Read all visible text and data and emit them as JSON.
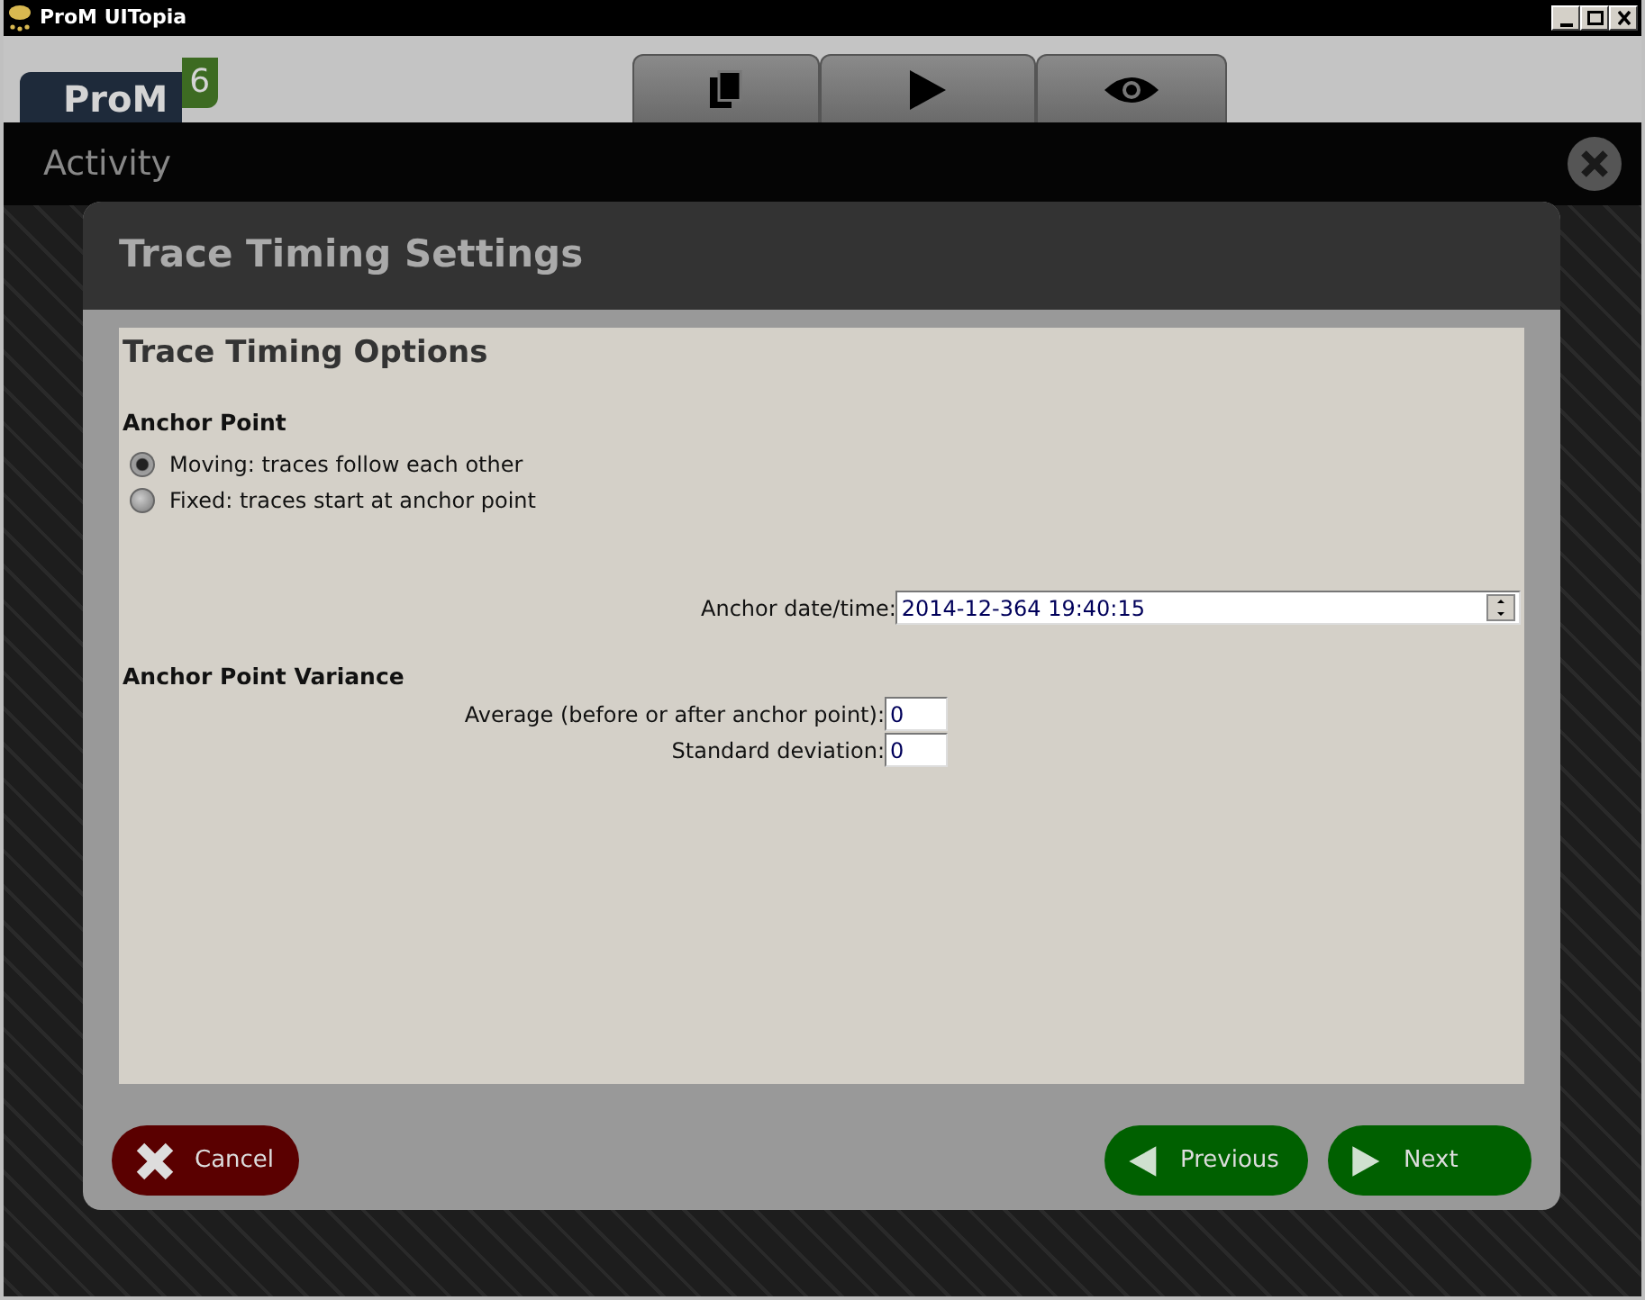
{
  "window": {
    "title": "ProM UITopia"
  },
  "logo": {
    "name": "ProM",
    "version": "6"
  },
  "tabs": [
    {
      "kind": "workspace"
    },
    {
      "kind": "actions"
    },
    {
      "kind": "views"
    }
  ],
  "activity": {
    "title": "Activity"
  },
  "dialog": {
    "title": "Trace Timing Settings",
    "section": "Trace Timing Options",
    "anchor_heading": "Anchor Point",
    "options": [
      {
        "label": "Moving: traces follow each other",
        "selected": true
      },
      {
        "label": "Fixed: traces start at anchor point",
        "selected": false
      }
    ],
    "anchor_label": "Anchor date/time:",
    "anchor_value": "2014-12-364 19:40:15",
    "variance_heading": "Anchor Point Variance",
    "variance_fields": [
      {
        "label": "Average (before or after anchor point):",
        "value": "0"
      },
      {
        "label": "Standard deviation:",
        "value": "0"
      }
    ]
  },
  "buttons": [
    {
      "kind": "cancel",
      "label": "Cancel"
    },
    {
      "kind": "previous",
      "label": "Previous"
    },
    {
      "kind": "next",
      "label": "Next"
    }
  ]
}
